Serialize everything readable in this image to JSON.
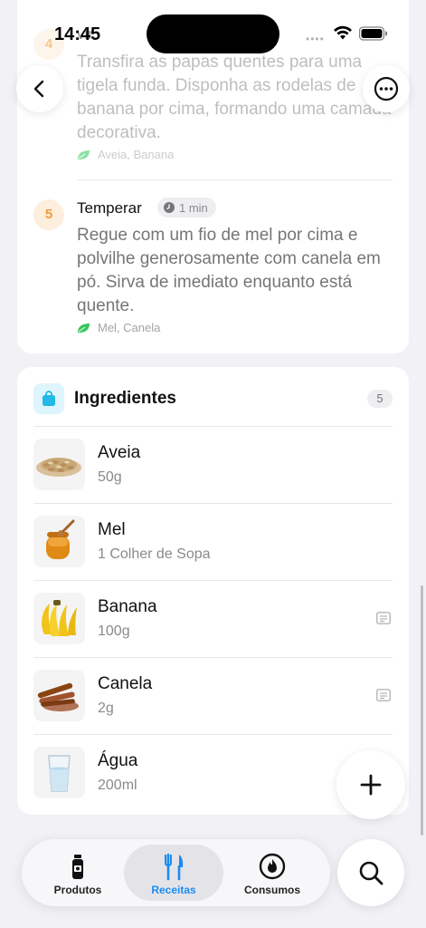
{
  "status_bar": {
    "time": "14:45"
  },
  "steps": {
    "step4": {
      "number": "4",
      "title_partial": "vir",
      "text": "Transfira as papas quentes para uma tigela funda. Disponha as rodelas de banana por cima, formando uma camada decorativa.",
      "ingredients": "Aveia, Banana"
    },
    "step5": {
      "number": "5",
      "title": "Temperar",
      "time": "1 min",
      "text": "Regue com um fio de mel por cima e polvilhe generosamente com canela em pó. Sirva de imediato enquanto está quente.",
      "ingredients": "Mel, Canela"
    }
  },
  "ingredients_section": {
    "title": "Ingredientes",
    "count": "5",
    "items": [
      {
        "name": "Aveia",
        "quantity": "50g",
        "has_note": false
      },
      {
        "name": "Mel",
        "quantity": "1 Colher de Sopa",
        "has_note": false
      },
      {
        "name": "Banana",
        "quantity": "100g",
        "has_note": true
      },
      {
        "name": "Canela",
        "quantity": "2g",
        "has_note": true
      },
      {
        "name": "Água",
        "quantity": "200ml",
        "has_note": false
      }
    ]
  },
  "tab_bar": {
    "tabs": [
      {
        "label": "Produtos",
        "icon": "bottle-icon"
      },
      {
        "label": "Receitas",
        "icon": "fork-knife-icon",
        "selected": true
      },
      {
        "label": "Consumos",
        "icon": "flame-icon"
      }
    ]
  },
  "colors": {
    "accent": "#1a8bf2",
    "step_badge_bg": "#fdeede",
    "step_badge_text": "#f29a3a",
    "leaf": "#34c759",
    "ingredient_icon": "#23b8e6"
  }
}
